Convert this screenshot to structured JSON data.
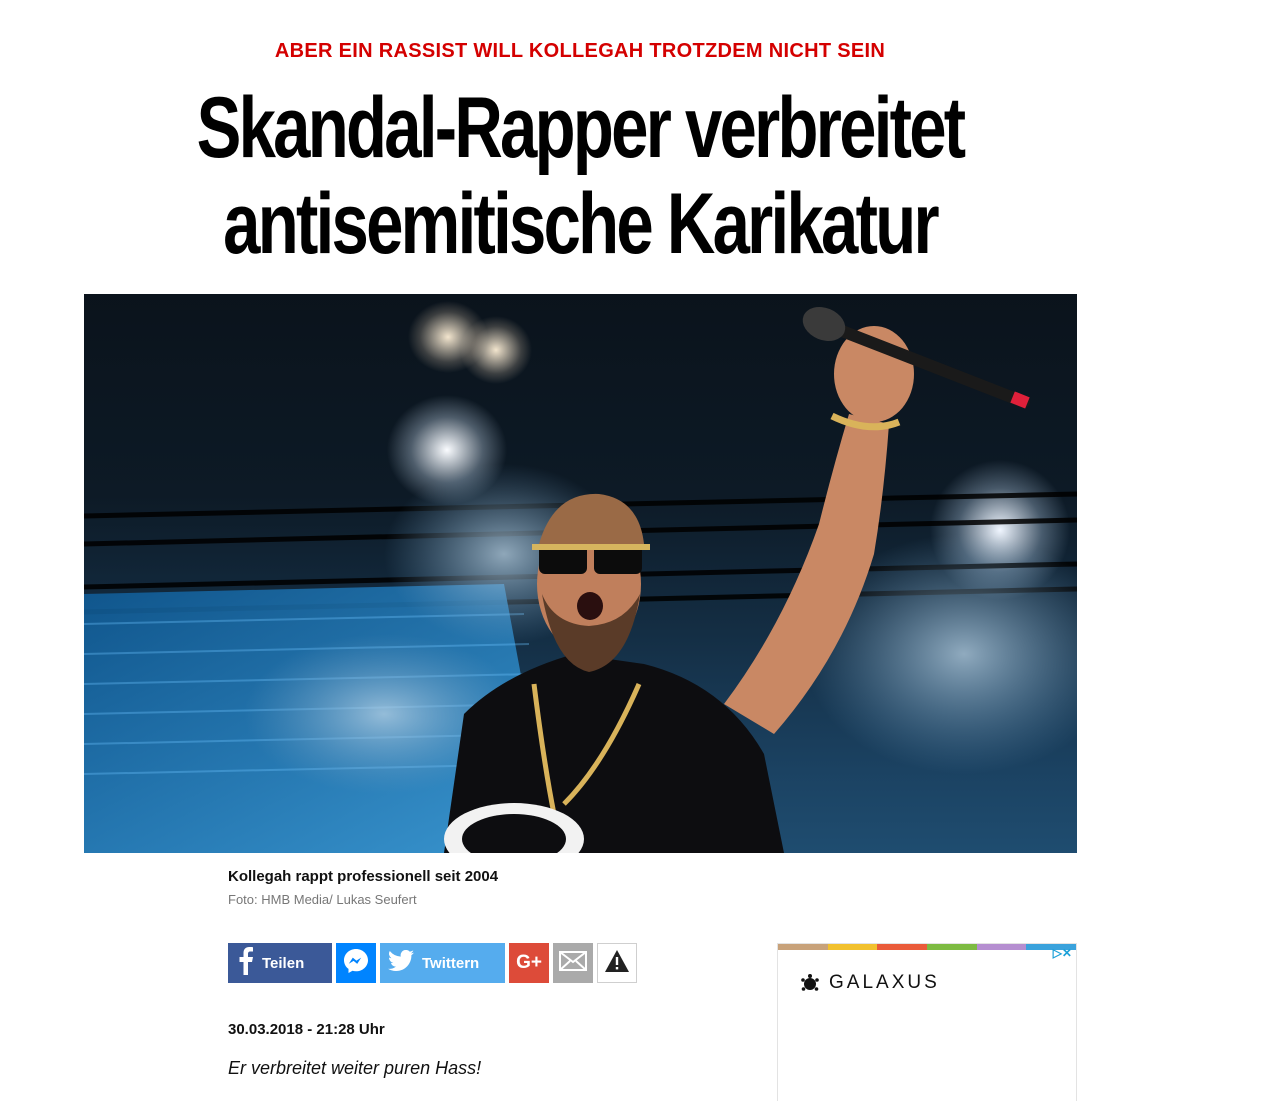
{
  "article": {
    "kicker": "ABER EIN RASSIST WILL KOLLEGAH TROTZDEM NICHT SEIN",
    "headline_line1": "Skandal-Rapper verbreitet",
    "headline_line2": "antisemitische Karikatur",
    "caption": "Kollegah rappt professionell seit 2004",
    "photo_credit": "Foto: HMB Media/ Lukas Seufert",
    "date": "30.03.2018 - 21:28 Uhr",
    "lead": "Er verbreitet weiter puren Hass!"
  },
  "share": {
    "facebook_label": "Teilen",
    "twitter_label": "Twittern",
    "googleplus_label": "G+",
    "icons": [
      "facebook-icon",
      "messenger-icon",
      "twitter-icon",
      "google-plus-icon",
      "mail-icon",
      "warning-icon"
    ]
  },
  "ad": {
    "brand": "GALAXUS",
    "choices_label": "▷✕",
    "stripe_colors": [
      "#c8a27a",
      "#f2c12e",
      "#ea5b3a",
      "#7dbb42",
      "#b58ed0",
      "#3aa2dc"
    ]
  },
  "colors": {
    "kicker": "#d40000",
    "facebook": "#3b5998",
    "messenger": "#0084ff",
    "twitter": "#55acee",
    "googleplus": "#dd4b39",
    "mail": "#aaaaaa"
  }
}
